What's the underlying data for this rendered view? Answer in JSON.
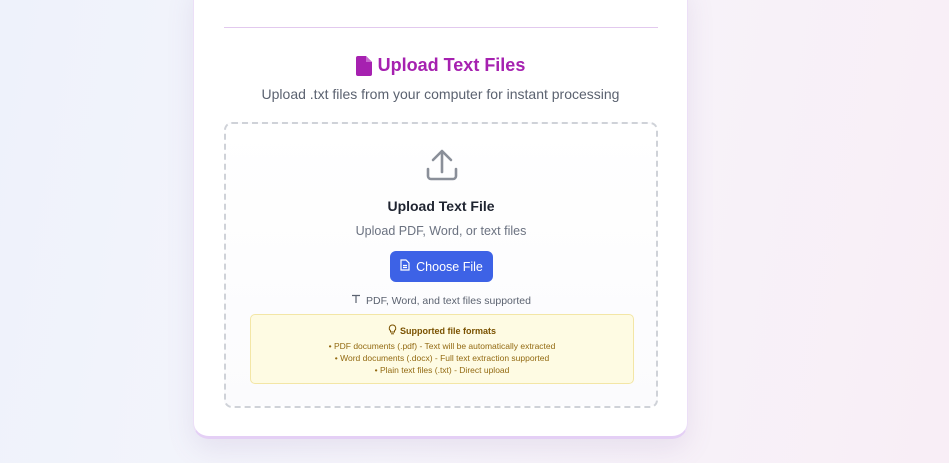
{
  "upload": {
    "title": "Upload Text Files",
    "subtitle": "Upload .txt files from your computer for instant processing",
    "title_icon": "document-icon",
    "accent_color": "#a621b0"
  },
  "dropzone": {
    "icon": "upload-icon",
    "title": "Upload Text File",
    "subtitle": "Upload PDF, Word, or text files",
    "button_label": "Choose File",
    "button_color": "#3d62e6",
    "supported_text": "PDF, Word, and text files supported"
  },
  "formats": {
    "heading": "Supported file formats",
    "icon": "lightbulb-icon",
    "items": [
      "• PDF documents (.pdf) - Text will be automatically extracted",
      "• Word documents (.docx) - Full text extraction supported",
      "• Plain text files (.txt) - Direct upload"
    ]
  }
}
